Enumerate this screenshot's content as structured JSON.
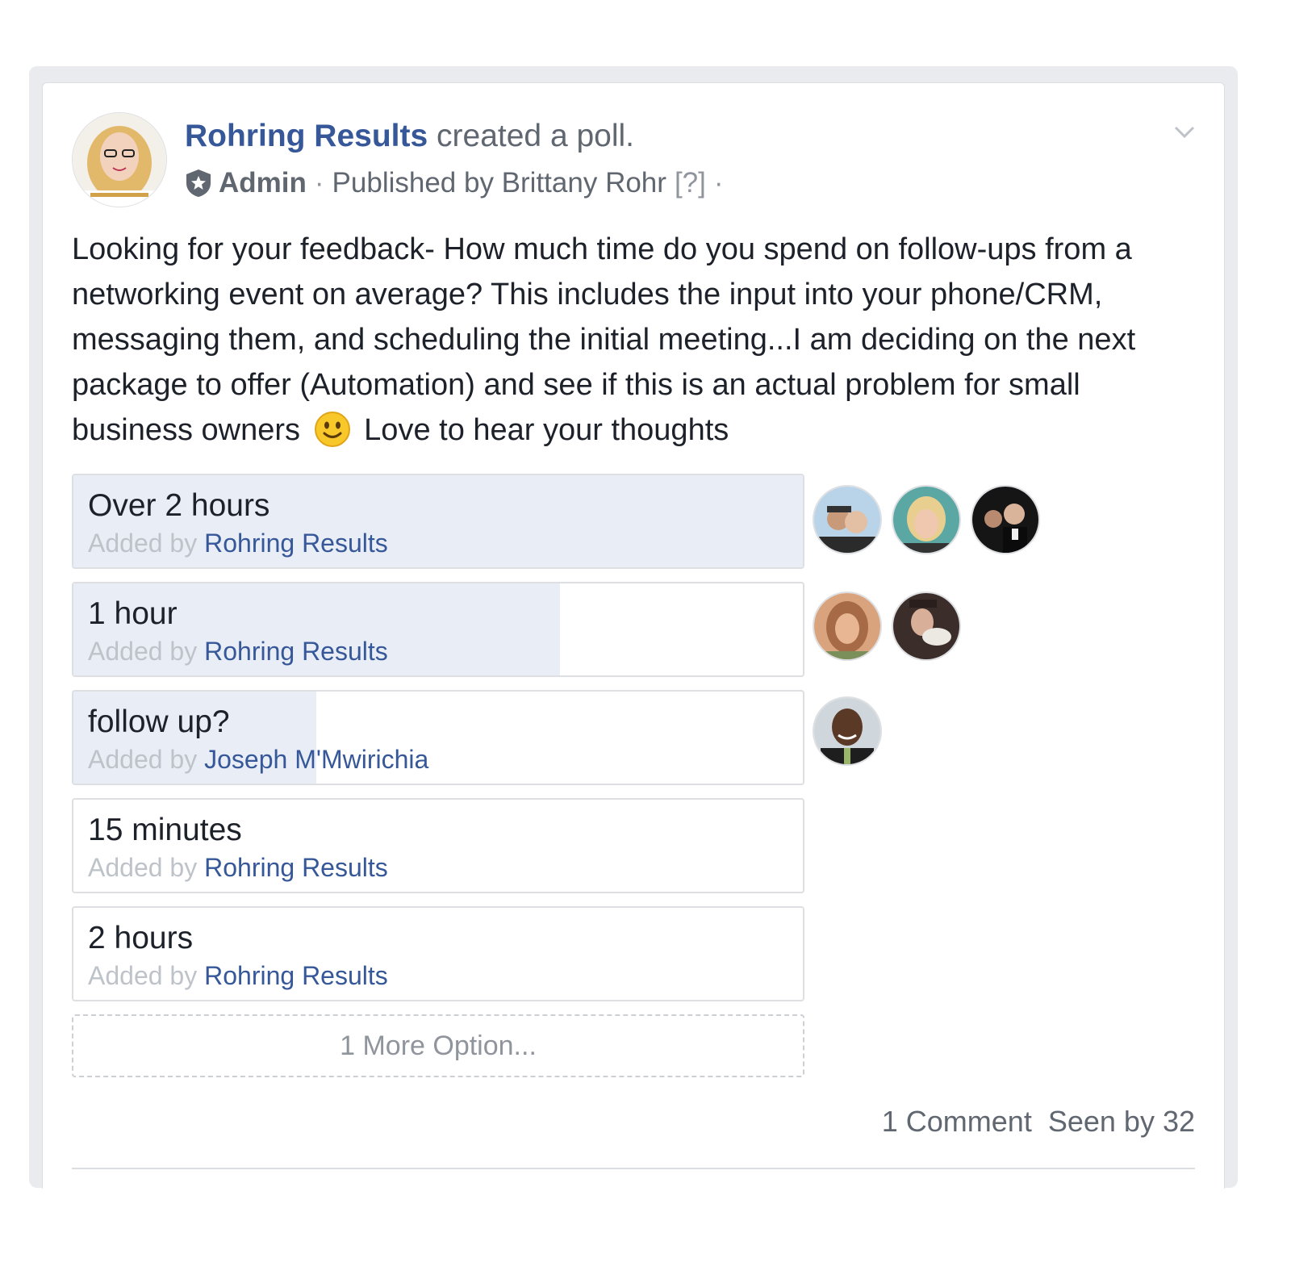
{
  "post": {
    "page_name": "Rohring Results",
    "action": " created a poll.",
    "role": "Admin",
    "published_prefix": "Published by Brittany Rohr",
    "help": "[?]",
    "text_before_emoji": "Looking for your feedback- How much time do you spend on follow-ups from a networking event on average? This includes the input into your phone/CRM, messaging them, and scheduling the initial meeting...I am deciding on the next package to offer (Automation) and see if this is an actual problem for small business owners",
    "text_after_emoji": "Love to hear your thoughts",
    "emoji": "slightly-smiling-face"
  },
  "poll": {
    "added_by_prefix": "Added by",
    "options": [
      {
        "label": "Over 2 hours",
        "added_by": "Rohring Results",
        "share": 1.0,
        "votes": 3
      },
      {
        "label": "1 hour",
        "added_by": "Rohring Results",
        "share": 0.667,
        "votes": 2
      },
      {
        "label": "follow up?",
        "added_by": "Joseph M'Mwirichia",
        "share": 0.333,
        "votes": 1
      },
      {
        "label": "15 minutes",
        "added_by": "Rohring Results",
        "share": 0,
        "votes": 0
      },
      {
        "label": "2 hours",
        "added_by": "Rohring Results",
        "share": 0,
        "votes": 0
      }
    ],
    "more_options": "1 More Option..."
  },
  "footer": {
    "comments": "1 Comment",
    "seen": "Seen by 32"
  },
  "colors": {
    "link": "#365899",
    "fill": "#e9edf6",
    "muted": "#606770"
  }
}
